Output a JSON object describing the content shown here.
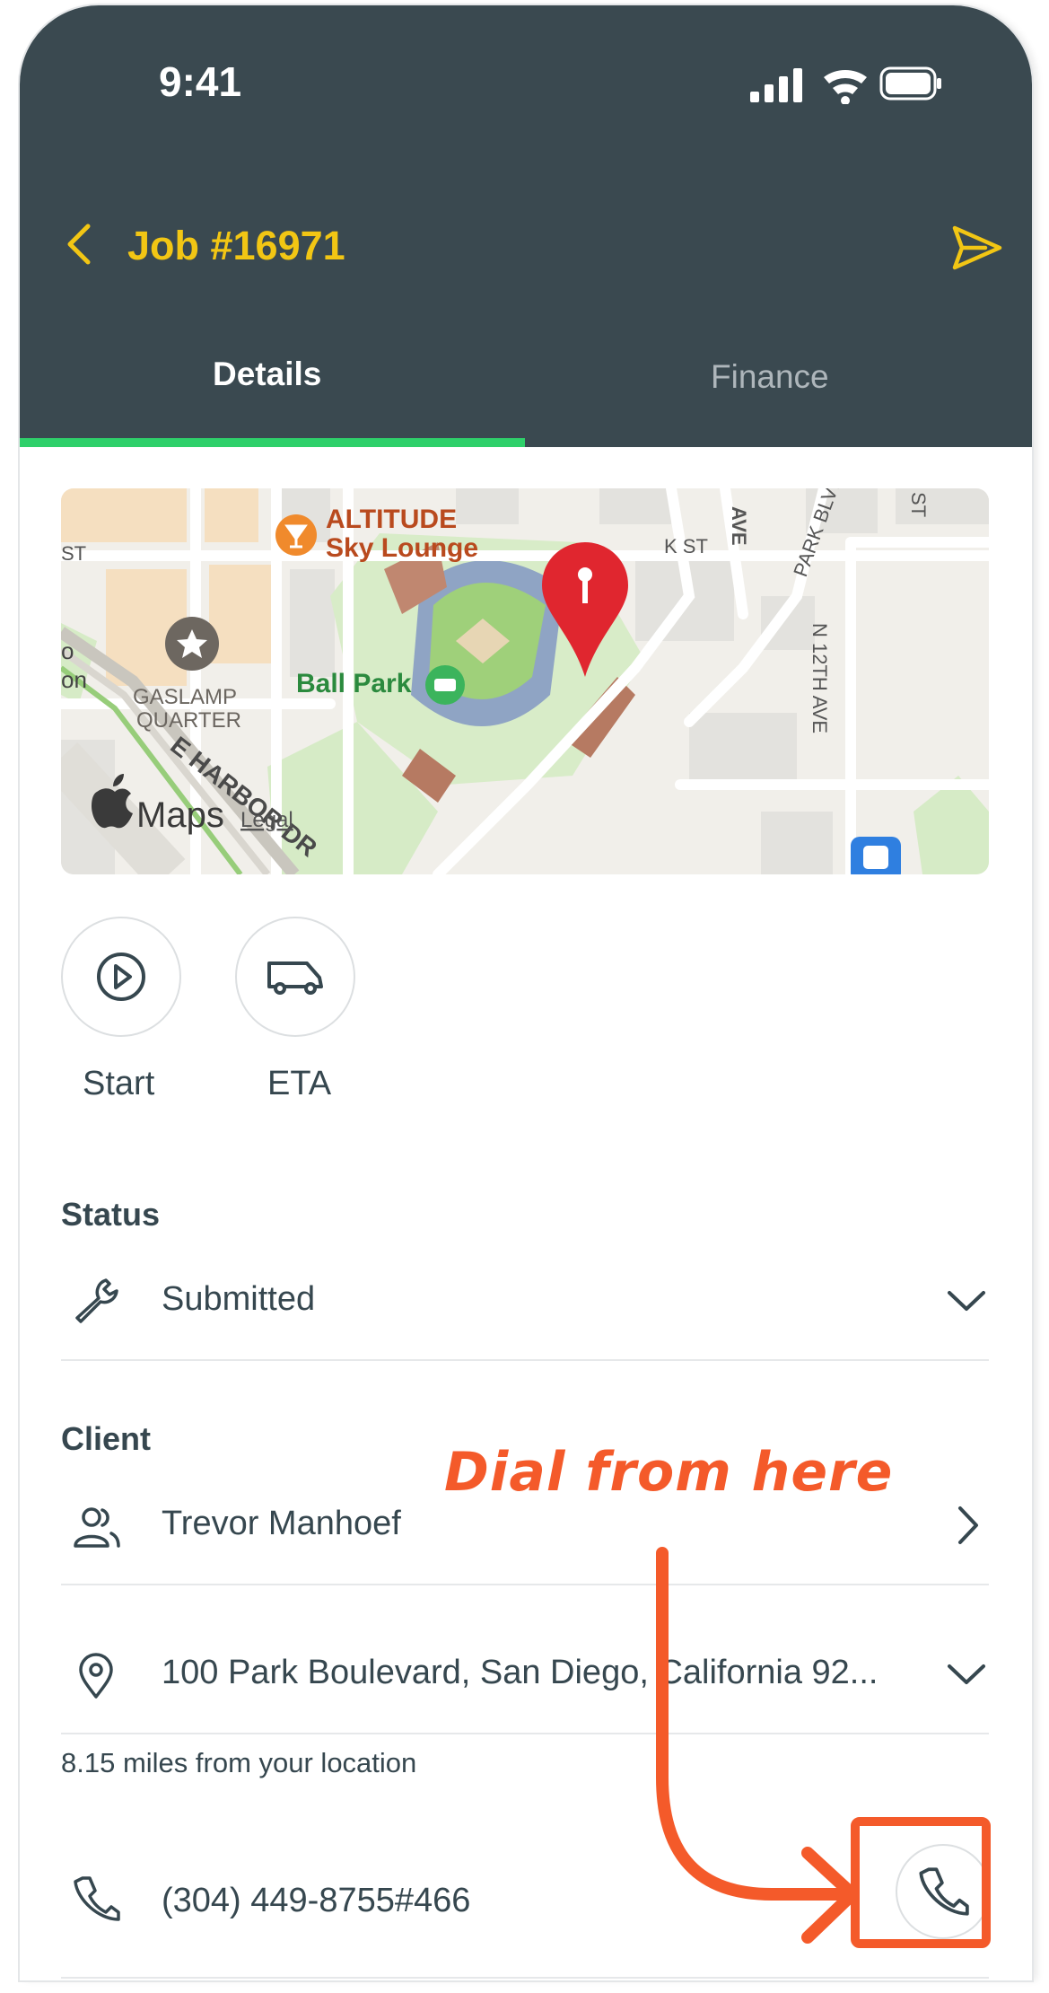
{
  "status_bar": {
    "time": "9:41"
  },
  "header": {
    "title": "Job #16971",
    "bg_color": "#3a4950",
    "accent_color": "#f2c614"
  },
  "tabs": [
    {
      "label": "Details",
      "active": true
    },
    {
      "label": "Finance",
      "active": false
    }
  ],
  "map": {
    "labels": {
      "lounge": "ALTITUDE",
      "lounge2": "Sky Lounge",
      "ballpark": "Ball Park",
      "gaslamp": "GASLAMP",
      "gaslamp2": "QUARTER",
      "harbor": "E HARBOR DR",
      "kst": "K ST",
      "ave": "AVE",
      "park": "PARK BLVD",
      "n12": "N 12TH AVE",
      "st": "ST",
      "st_left": "ST",
      "o": "o",
      "on": "on",
      "brand": "Maps",
      "legal": "Legal"
    }
  },
  "actions": [
    {
      "label": "Start",
      "icon": "play-circle-icon"
    },
    {
      "label": "ETA",
      "icon": "van-icon"
    }
  ],
  "status": {
    "label": "Status",
    "value": "Submitted"
  },
  "client": {
    "label": "Client",
    "name": "Trevor Manhoef"
  },
  "address": {
    "value": "100 Park Boulevard, San Diego, California 92...",
    "distance": "8.15 miles from your location"
  },
  "phone": {
    "value": "(304) 449-8755#466"
  },
  "annotation": {
    "text": "Dial from here",
    "color": "#f45a2a"
  }
}
